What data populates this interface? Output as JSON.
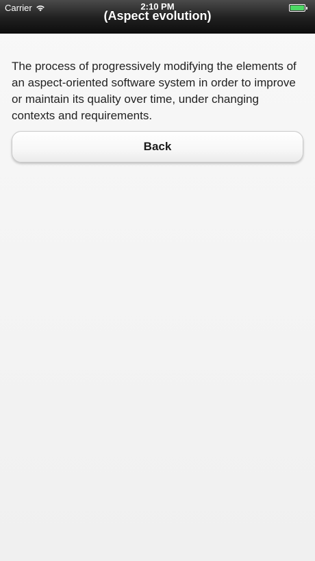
{
  "status_bar": {
    "carrier": "Carrier",
    "time": "2:10 PM",
    "wifi_icon": "wifi-icon",
    "battery_icon": "battery-icon",
    "battery_color": "#4cd964"
  },
  "nav": {
    "title": "(Aspect evolution)"
  },
  "content": {
    "description": "The process of progressively modifying the elements of an aspect-oriented software system in order to improve or maintain its quality over time, under changing contexts and requirements.",
    "back_label": "Back"
  }
}
